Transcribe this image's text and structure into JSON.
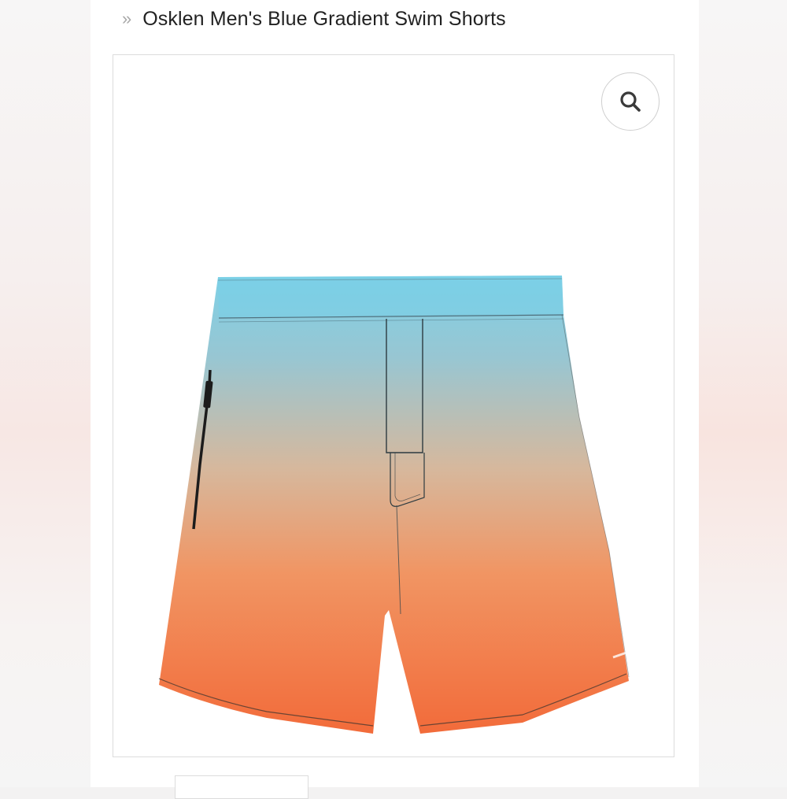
{
  "breadcrumb": {
    "separator": "»",
    "title": "Osklen Men's Blue Gradient Swim Shorts"
  },
  "product_image": {
    "alt": "Osklen Men's Blue Gradient Swim Shorts",
    "colors": {
      "top": "#7ed0e6",
      "middle": "#d6b89d",
      "bottom": "#f26b3a"
    }
  },
  "zoom": {
    "icon": "search-icon"
  }
}
